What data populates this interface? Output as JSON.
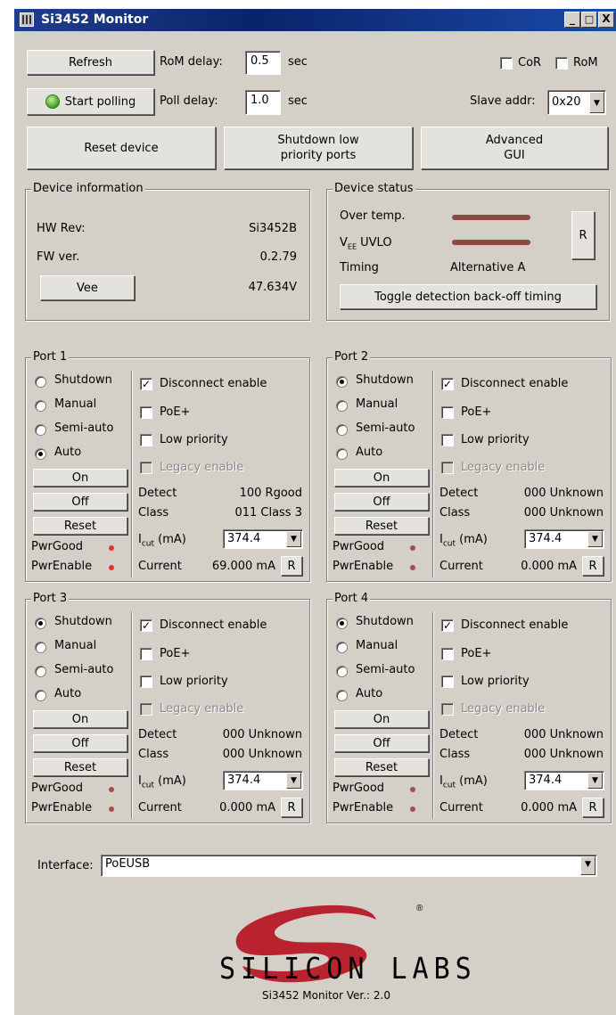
{
  "window": {
    "title": "Si3452 Monitor",
    "minimize": "_",
    "maximize": "□",
    "close": "X"
  },
  "top": {
    "refresh": "Refresh",
    "rom_delay_label": "RoM delay:",
    "rom_delay": "0.5",
    "sec1": "sec",
    "cor": "CoR",
    "rom": "RoM",
    "start_polling": "Start polling",
    "poll_delay_label": "Poll delay:",
    "poll_delay": "1.0",
    "sec2": "sec",
    "slave_label": "Slave addr:",
    "slave_value": "0x20",
    "reset_device": "Reset device",
    "shutdown_low_1": "Shutdown low",
    "shutdown_low_2": "priority ports",
    "advanced_1": "Advanced",
    "advanced_2": "GUI"
  },
  "device_info": {
    "title": "Device information",
    "hw_label": "HW Rev:",
    "hw_value": "Si3452B",
    "fw_label": "FW ver.",
    "fw_value": "0.2.79",
    "vee_button": "Vee",
    "vee_value": "47.634V"
  },
  "device_status": {
    "title": "Device status",
    "over_temp": "Over temp.",
    "vee_uvlo_main": "V",
    "vee_uvlo_sub": "EE",
    "vee_uvlo_rest": " UVLO",
    "timing_label": "Timing",
    "timing_value": "Alternative A",
    "r_button": "R",
    "toggle": "Toggle detection back-off timing",
    "bar_color": "#8b4a3e"
  },
  "modes": {
    "shutdown": "Shutdown",
    "manual": "Manual",
    "semi": "Semi-auto",
    "auto": "Auto"
  },
  "port_labels": {
    "disconnect": "Disconnect enable",
    "poe": "PoE+",
    "low": "Low priority",
    "legacy": "Legacy enable",
    "on": "On",
    "off": "Off",
    "reset": "Reset",
    "pwrgood": "PwrGood",
    "pwrenable": "PwrEnable",
    "detect": "Detect",
    "class": "Class",
    "icut_main": "I",
    "icut_sub": "cut",
    "icut_rest": " (mA)",
    "current": "Current",
    "r": "R",
    "check": "✓"
  },
  "ports": [
    {
      "title": "Port 1",
      "mode": "auto",
      "detect": "100 Rgood",
      "class": "011 Class 3",
      "icut": "374.4",
      "current": "69.000 mA",
      "led_color": "#e8332a"
    },
    {
      "title": "Port 2",
      "mode": "shutdown",
      "detect": "000 Unknown",
      "class": "000 Unknown",
      "icut": "374.4",
      "current": "0.000 mA",
      "led_color": "#a0524a"
    },
    {
      "title": "Port 3",
      "mode": "shutdown",
      "detect": "000 Unknown",
      "class": "000 Unknown",
      "icut": "374.4",
      "current": "0.000 mA",
      "led_color": "#a0524a"
    },
    {
      "title": "Port 4",
      "mode": "shutdown",
      "detect": "000 Unknown",
      "class": "000 Unknown",
      "icut": "374.4",
      "current": "0.000 mA",
      "led_color": "#a0524a"
    }
  ],
  "interface": {
    "label": "Interface:",
    "value": "PoEUSB"
  },
  "logo": {
    "brand": "SILICON LABS",
    "registered": "®",
    "version": "Si3452 Monitor Ver.: 2.0",
    "color": "#b8232f"
  }
}
